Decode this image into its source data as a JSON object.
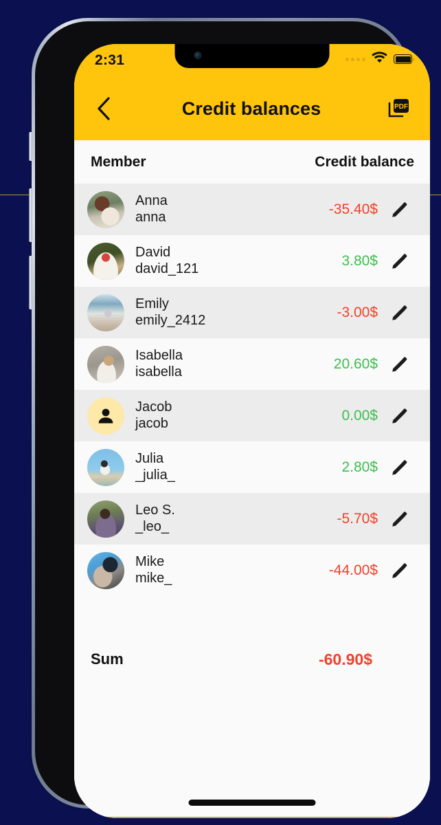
{
  "status_bar": {
    "time": "2:31",
    "cellular_icon": "cellular-dots-icon",
    "wifi_icon": "wifi-icon",
    "battery_icon": "battery-full-icon"
  },
  "header": {
    "back_icon": "back-chevron-icon",
    "title": "Credit balances",
    "pdf_icon": "pdf-export-icon"
  },
  "table": {
    "columns": {
      "member": "Member",
      "balance": "Credit balance"
    },
    "edit_icon": "pencil-edit-icon",
    "rows": [
      {
        "name": "Anna",
        "handle": "anna",
        "amount": "-35.40$",
        "sign": "neg",
        "avatar": "photo",
        "avatar_class": "ph-anna"
      },
      {
        "name": "David",
        "handle": "david_121",
        "amount": "3.80$",
        "sign": "pos",
        "avatar": "photo",
        "avatar_class": "ph-david"
      },
      {
        "name": "Emily",
        "handle": "emily_2412",
        "amount": "-3.00$",
        "sign": "neg",
        "avatar": "photo",
        "avatar_class": "ph-emily"
      },
      {
        "name": "Isabella",
        "handle": "isabella",
        "amount": "20.60$",
        "sign": "pos",
        "avatar": "photo",
        "avatar_class": "ph-isabella"
      },
      {
        "name": "Jacob",
        "handle": "jacob",
        "amount": "0.00$",
        "sign": "pos",
        "avatar": "placeholder",
        "avatar_class": ""
      },
      {
        "name": "Julia",
        "handle": "_julia_",
        "amount": "2.80$",
        "sign": "pos",
        "avatar": "photo",
        "avatar_class": "ph-julia"
      },
      {
        "name": "Leo S.",
        "handle": "_leo_",
        "amount": "-5.70$",
        "sign": "neg",
        "avatar": "photo",
        "avatar_class": "ph-leo"
      },
      {
        "name": "Mike",
        "handle": "mike_",
        "amount": "-44.00$",
        "sign": "neg",
        "avatar": "photo",
        "avatar_class": "ph-mike"
      }
    ]
  },
  "summary": {
    "label": "Sum",
    "value": "-60.90$"
  },
  "colors": {
    "header_yellow": "#ffc40c",
    "negative": "#f0412a",
    "positive": "#3dbe4e",
    "row_alt": "#ececec",
    "row_base": "#fafafa",
    "backdrop": "#0a1050",
    "placeholder_avatar": "#ffe9a8"
  }
}
